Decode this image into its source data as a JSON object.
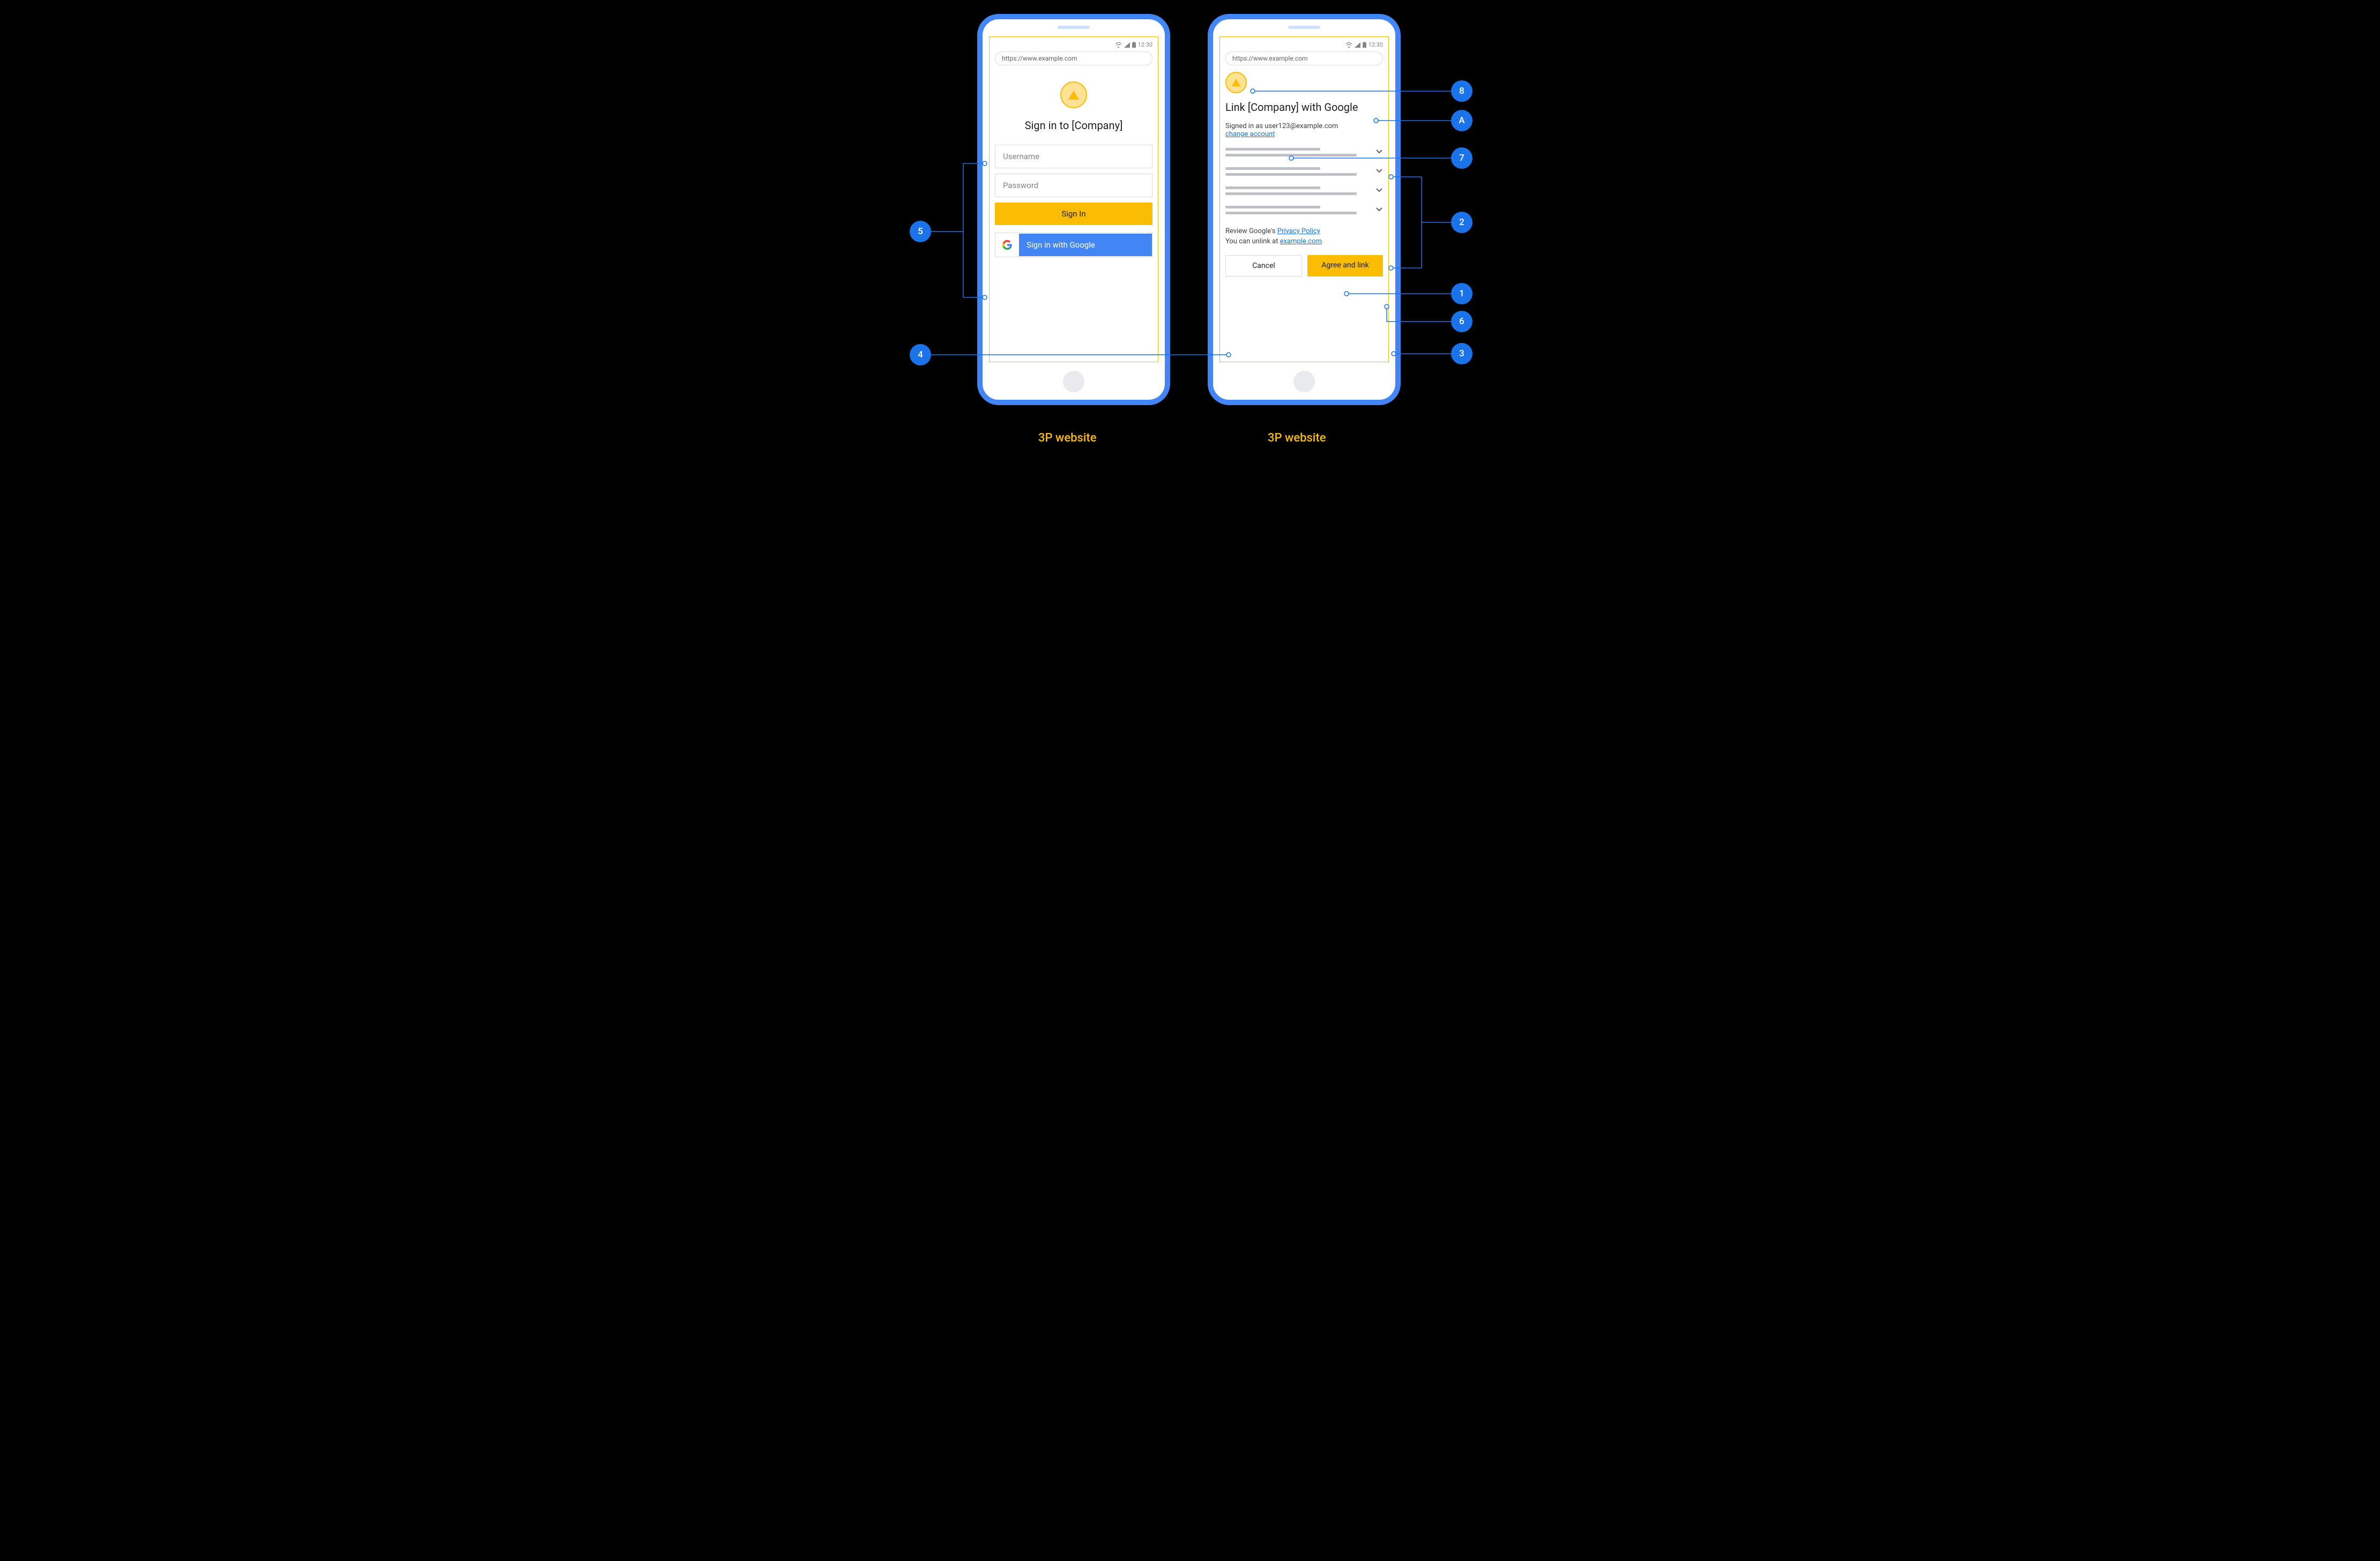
{
  "status": {
    "time": "12:30"
  },
  "url": "https://www.example.com",
  "screen1": {
    "heading": "Sign in to [Company]",
    "username_placeholder": "Username",
    "password_placeholder": "Password",
    "signin_btn": "Sign In",
    "google_btn": "Sign in with Google"
  },
  "screen2": {
    "heading": "Link [Company] with Google",
    "signed_in_as": "Signed in as user123@example.com",
    "change_account": "change account",
    "review_prefix": "Review Google's ",
    "privacy_link": "Privacy Policy",
    "unlink_prefix": "You can unlink at ",
    "unlink_link": "example.com",
    "cancel_btn": "Cancel",
    "agree_btn": "Agree and link"
  },
  "labels": {
    "left": "3P website",
    "right": "3P website"
  },
  "callouts": {
    "c1": "1",
    "c2": "2",
    "c3": "3",
    "c4": "4",
    "c5": "5",
    "c6": "6",
    "c7": "7",
    "c8": "8",
    "cA": "A"
  }
}
